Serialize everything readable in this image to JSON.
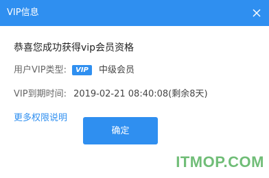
{
  "dialog": {
    "title": "VIP信息",
    "close_icon": "close-icon",
    "accent_color": "#2f8ff0"
  },
  "content": {
    "congrats": "恭喜您成功获得vip会员资格",
    "type_label": "用户VIP类型:",
    "badge": "VIP",
    "level": "中级会员",
    "expire_label": "VIP到期时间:",
    "expire_value": "2019-02-21 08:40:08(剩余8天)",
    "more_link": "更多权限说明"
  },
  "actions": {
    "confirm_label": "确定"
  },
  "watermark": "ITMOP.COM"
}
